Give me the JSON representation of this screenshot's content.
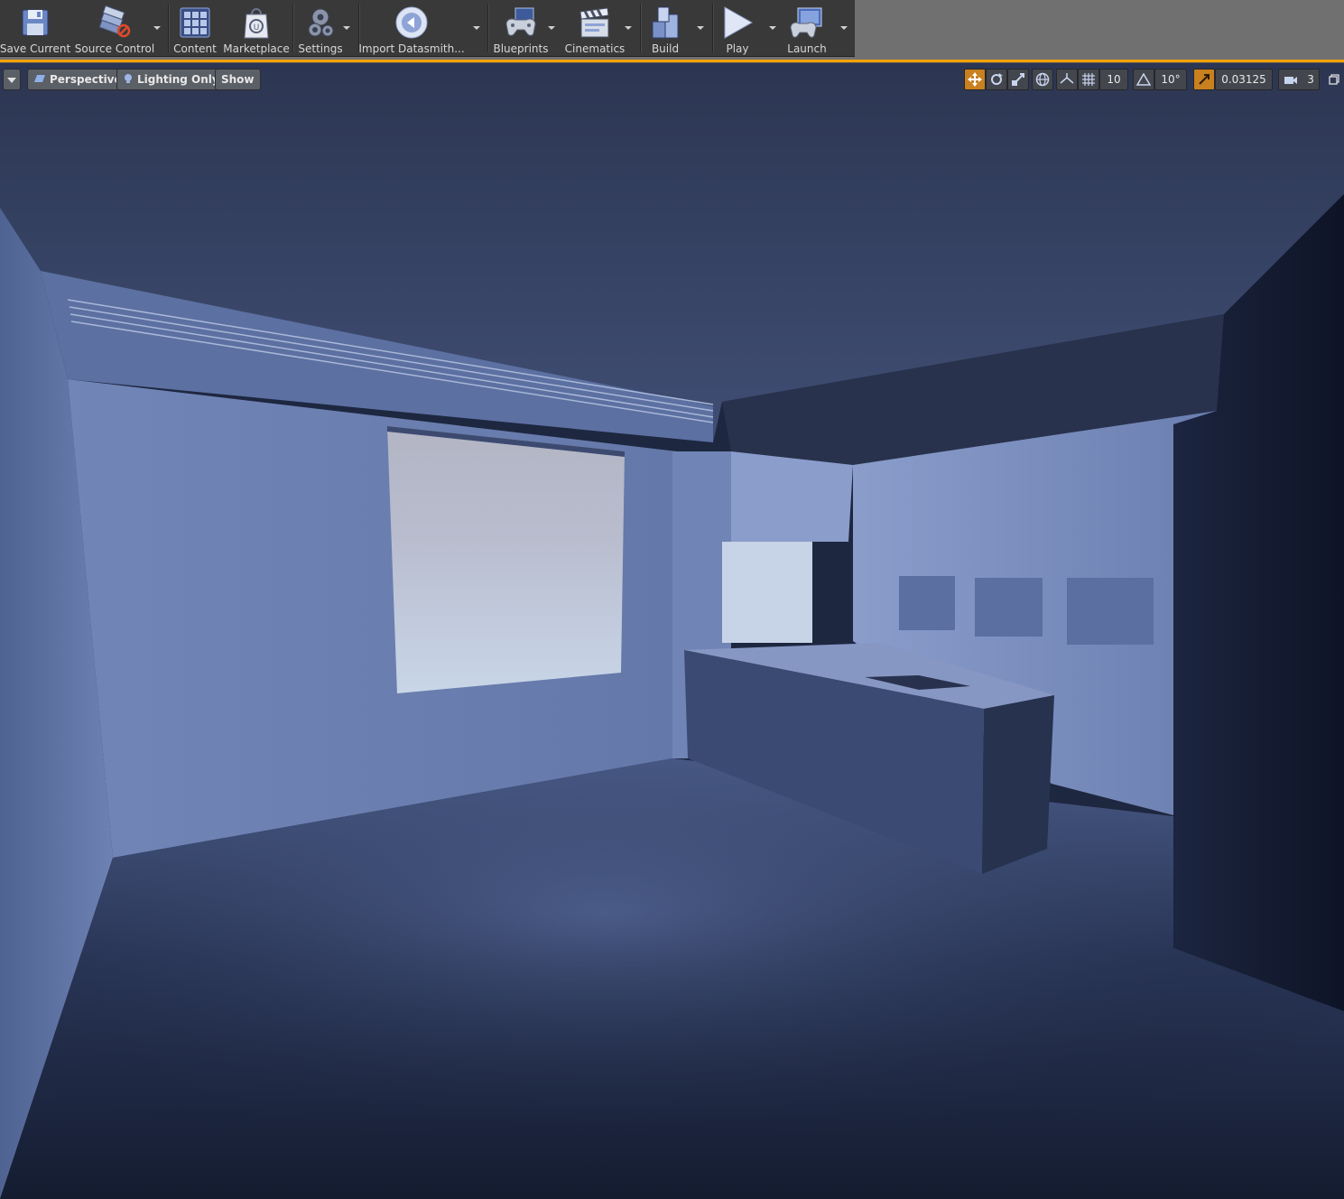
{
  "toolbar": {
    "buttons": [
      {
        "label": "Save Current",
        "icon": "save-icon"
      },
      {
        "label": "Source Control",
        "icon": "source-control-icon"
      },
      {
        "label": "Content",
        "icon": "content-icon"
      },
      {
        "label": "Marketplace",
        "icon": "marketplace-icon"
      },
      {
        "label": "Settings",
        "icon": "settings-icon"
      },
      {
        "label": "Import Datasmith...",
        "icon": "datasmith-icon"
      },
      {
        "label": "Blueprints",
        "icon": "blueprints-icon"
      },
      {
        "label": "Cinematics",
        "icon": "cinematics-icon"
      },
      {
        "label": "Build",
        "icon": "build-icon"
      },
      {
        "label": "Play",
        "icon": "play-icon"
      },
      {
        "label": "Launch",
        "icon": "launch-icon"
      }
    ]
  },
  "viewport": {
    "view_mode_label": "Perspective",
    "lighting_label": "Lighting Only",
    "show_label": "Show",
    "grid_snap_value": "10",
    "rotation_snap_value": "10°",
    "scale_snap_value": "0.03125",
    "camera_speed_value": "3"
  },
  "colors": {
    "accent": "#f3a20a",
    "toolbar_bg": "#393939",
    "active_tool": "#c9801f"
  }
}
